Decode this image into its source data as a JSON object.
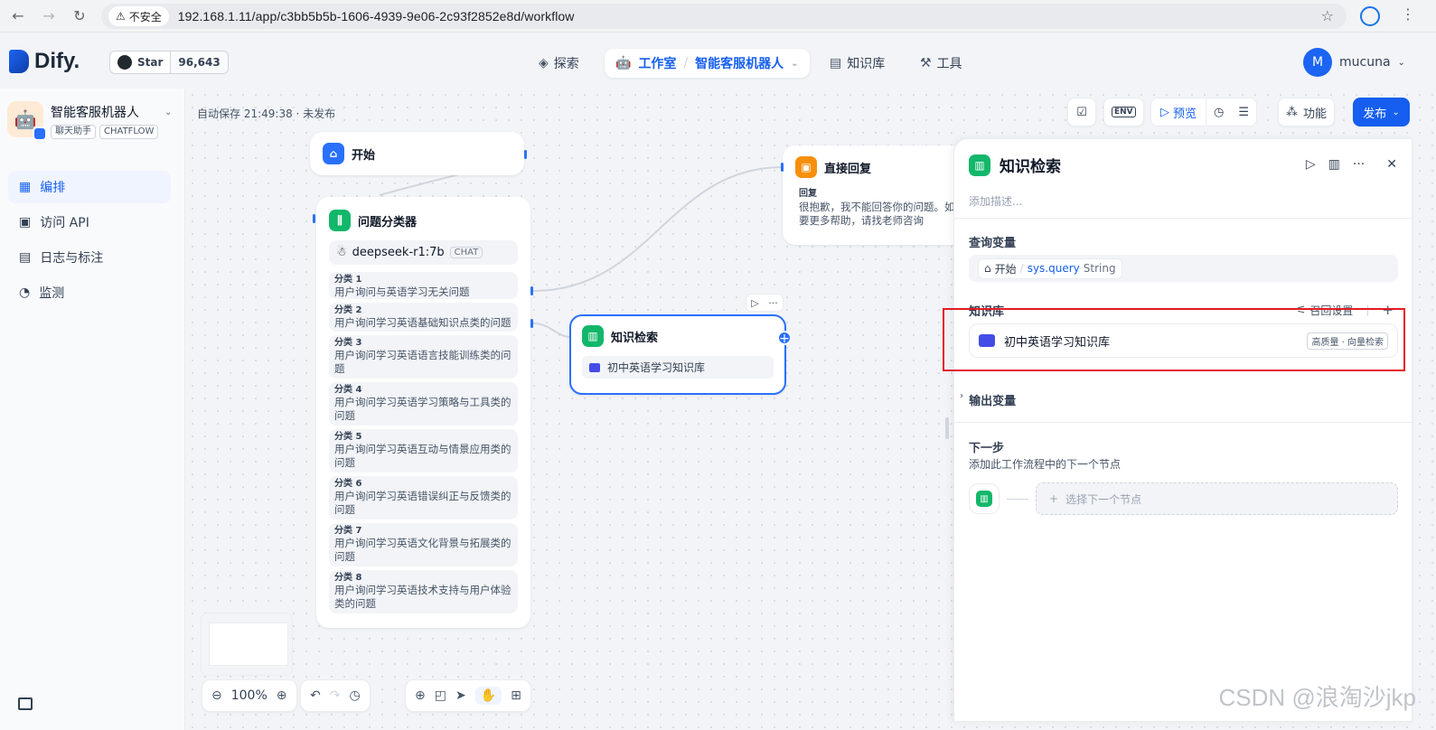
{
  "browser": {
    "insecure_label": "不安全",
    "url": "192.168.1.11/app/c3bb5b5b-1606-4939-9e06-2c93f2852e8d/workflow"
  },
  "header": {
    "logo_text": "Dify.",
    "github_label": "Star",
    "github_count": "96,643",
    "nav_explore": "探索",
    "nav_studio": "工作室",
    "nav_app": "智能客服机器人",
    "nav_knowledge": "知识库",
    "nav_tools": "工具",
    "user_initial": "M",
    "user_name": "mucuna"
  },
  "sidebar": {
    "app_name": "智能客服机器人",
    "tag1": "聊天助手",
    "tag2": "CHATFLOW",
    "items": [
      {
        "label": "编排"
      },
      {
        "label": "访问 API"
      },
      {
        "label": "日志与标注"
      },
      {
        "label": "监测"
      }
    ]
  },
  "canvas": {
    "autosave": "自动保存 21:49:38 · 未发布",
    "toolbar": {
      "env": "ENV",
      "preview": "预览",
      "features": "功能",
      "publish": "发布"
    },
    "start_node": {
      "title": "开始"
    },
    "reply_node": {
      "title": "直接回复",
      "label": "回复",
      "text": "很抱歉，我不能回答你的问题。如果需要更多帮助，请找老师咨询"
    },
    "classifier_node": {
      "title": "问题分类器",
      "model": "deepseek-r1:7b",
      "model_tag": "CHAT",
      "classes": [
        {
          "title": "分类 1",
          "text": "用户询问与英语学习无关问题"
        },
        {
          "title": "分类 2",
          "text": "用户询问学习英语基础知识点类的问题"
        },
        {
          "title": "分类 3",
          "text": "用户询问学习英语语言技能训练类的问题"
        },
        {
          "title": "分类 4",
          "text": "用户询问学习英语学习策略与工具类的问题"
        },
        {
          "title": "分类 5",
          "text": "用户询问学习英语互动与情景应用类的问题"
        },
        {
          "title": "分类 6",
          "text": "用户询问学习英语错误纠正与反馈类的问题"
        },
        {
          "title": "分类 7",
          "text": "用户询问学习英语文化背景与拓展类的问题"
        },
        {
          "title": "分类 8",
          "text": "用户询问学习英语技术支持与用户体验类的问题"
        }
      ]
    },
    "kr_node": {
      "title": "知识检索",
      "kb": "初中英语学习知识库"
    },
    "zoom": "100%"
  },
  "panel": {
    "title": "知识检索",
    "desc_placeholder": "添加描述...",
    "query_label": "查询变量",
    "query_node": "开始",
    "query_var": "sys.query",
    "query_type": "String",
    "kb_label": "知识库",
    "recall_label": "召回设置",
    "kb_name": "初中英语学习知识库",
    "kb_badge": "高质量 · 向量检索",
    "output_label": "输出变量",
    "next_label": "下一步",
    "next_desc": "添加此工作流程中的下一个节点",
    "next_select": "选择下一个节点"
  },
  "watermark": "CSDN @浪淘沙jkp"
}
